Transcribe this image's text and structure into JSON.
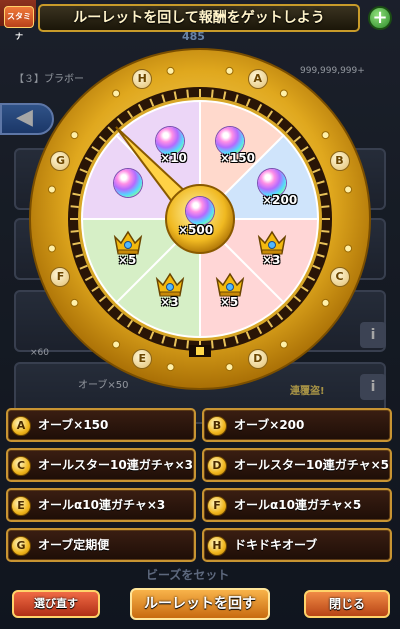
{
  "header": {
    "stamina_label": "スタミナ",
    "title": "ルーレットを回して報酬をゲットしよう",
    "plus": "+"
  },
  "background": {
    "counter": "485",
    "stage_label": "【３】ブラボー",
    "orb_count": "999,999,999+",
    "item_count": "×60",
    "orb_row_label": "オーブ×50",
    "status_label": "連覆盗!",
    "set_label": "ビーズをセット",
    "info": "i"
  },
  "roulette": {
    "ring_letters": [
      "A",
      "B",
      "C",
      "D",
      "E",
      "F",
      "G",
      "H"
    ],
    "segments": [
      {
        "letter": "A",
        "reward": "orb",
        "label": "×150",
        "color": "#ffd9cc"
      },
      {
        "letter": "B",
        "reward": "orb",
        "label": "×200",
        "color": "#cfe4fb"
      },
      {
        "letter": "C",
        "reward": "crown",
        "label": "×3",
        "color": "#ffd6d6"
      },
      {
        "letter": "D",
        "reward": "crown",
        "label": "×5",
        "color": "#ffd6d6"
      },
      {
        "letter": "E",
        "reward": "crown",
        "label": "×3",
        "color": "#d6efc6"
      },
      {
        "letter": "F",
        "reward": "crown",
        "label": "×5",
        "color": "#d6efc6"
      },
      {
        "letter": "G",
        "reward": "orb",
        "label": "",
        "color": "#ecd6f7"
      },
      {
        "letter": "H",
        "reward": "orb",
        "label": "×10",
        "color": "#ecd6f7"
      }
    ],
    "center_label": "×500"
  },
  "rewards": [
    {
      "letter": "A",
      "text": "オーブ×150"
    },
    {
      "letter": "B",
      "text": "オーブ×200"
    },
    {
      "letter": "C",
      "text": "オールスター10連ガチャ×3"
    },
    {
      "letter": "D",
      "text": "オールスター10連ガチャ×5"
    },
    {
      "letter": "E",
      "text": "オールα10連ガチャ×3"
    },
    {
      "letter": "F",
      "text": "オールα10連ガチャ×5"
    },
    {
      "letter": "G",
      "text": "オーブ定期便"
    },
    {
      "letter": "H",
      "text": "ドキドキオーブ"
    }
  ],
  "buttons": {
    "choose_again": "選び直す",
    "spin": "ルーレットを回す",
    "close": "閉じる"
  },
  "colors": {
    "gold": "#d9a521",
    "gold_dark": "#8a5a00",
    "panel_bg": "#2a150b"
  }
}
